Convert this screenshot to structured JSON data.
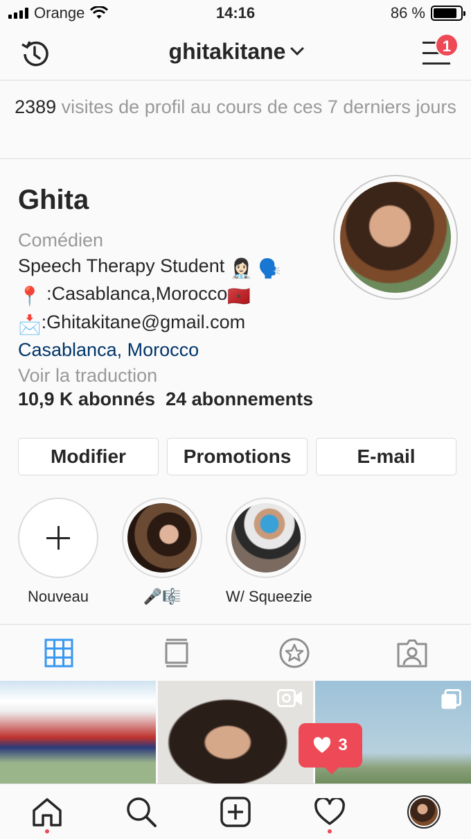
{
  "status_bar": {
    "carrier": "Orange",
    "time": "14:16",
    "battery": "86 %",
    "battery_level": 0.86
  },
  "header": {
    "username": "ghitakitane",
    "notification_count": "1"
  },
  "insights": {
    "count": "2389",
    "text": " visites de profil au cours de ces 7 derniers jours"
  },
  "profile": {
    "name": "Ghita",
    "category": "Comédien",
    "bio_line1": "Speech Therapy Student",
    "bio_line2": ":Casablanca,Morocco",
    "bio_line3": ":Ghitakitane@gmail.com",
    "location": "Casablanca, Morocco",
    "translate": "Voir la traduction",
    "followers": "10,9 K abonnés",
    "following": "24 abonnements"
  },
  "buttons": {
    "edit": "Modifier",
    "promotions": "Promotions",
    "email": "E-mail"
  },
  "highlights": [
    {
      "label": "Nouveau",
      "icon": "plus-icon"
    },
    {
      "label": "🎤🎼"
    },
    {
      "label": "W/ Squeezie"
    }
  ],
  "tabs": [
    "grid-icon",
    "feed-icon",
    "star-icon",
    "tagged-icon"
  ],
  "like_toast": {
    "count": "3"
  },
  "bottom_nav": [
    "home-icon",
    "search-icon",
    "add-icon",
    "heart-icon",
    "profile-icon"
  ],
  "colors": {
    "accent_blue": "#3897f0",
    "badge_red": "#ed4956",
    "link_blue": "#003569"
  }
}
